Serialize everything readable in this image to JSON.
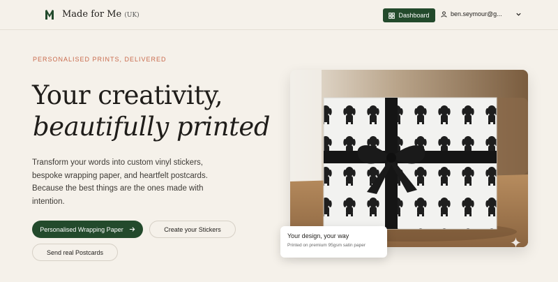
{
  "header": {
    "brand": "Made for Me",
    "brand_suffix": "(UK)",
    "dashboard_label": "Dashboard",
    "user_email": "ben.seymour@g..."
  },
  "hero": {
    "eyebrow": "PERSONALISED PRINTS, DELIVERED",
    "title_line1": "Your creativity,",
    "title_line2": "beautifully printed",
    "description": "Transform your words into custom vinyl stickers, bespoke wrapping paper, and heartfelt postcards. Because the best things are the ones made with intention."
  },
  "actions": {
    "wrapping_label": "Personalised Wrapping Paper",
    "stickers_label": "Create your Stickers",
    "postcards_label": "Send real Postcards"
  },
  "feature_card": {
    "title": "Your design, your way",
    "subtitle": "Printed on premium 95gsm satin paper"
  },
  "icons": {
    "logo": "logo-mark-icon",
    "dashboard": "grid-icon",
    "user": "user-icon",
    "dropdown": "chevron-down-icon",
    "arrow": "arrow-right-icon",
    "sparkle": "sparkle-icon"
  },
  "colors": {
    "background": "#f5f1ea",
    "brand_green": "#234a2c",
    "eyebrow_accent": "#c96a4c",
    "text_dark": "#1f1d1a"
  }
}
